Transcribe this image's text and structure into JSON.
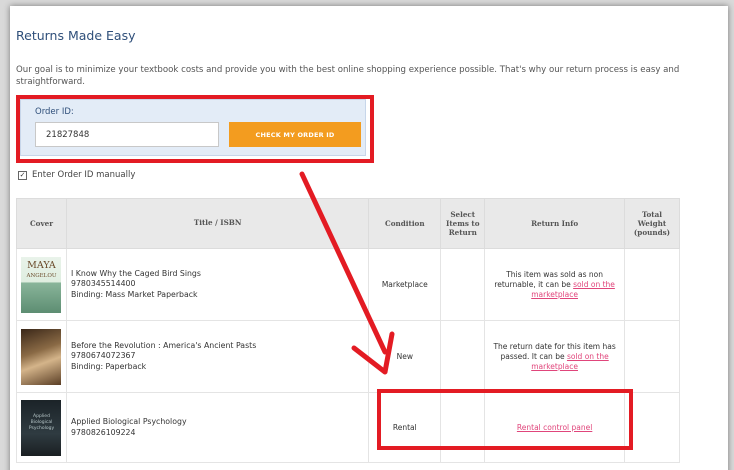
{
  "page": {
    "title": "Returns Made Easy",
    "intro": "Our goal is to minimize your textbook costs and provide you with the best online shopping experience possible. That's why our return process is easy and straightforward."
  },
  "order": {
    "label": "Order ID:",
    "value": "21827848",
    "button": "CHECK MY ORDER ID"
  },
  "manual": {
    "label": "Enter Order ID manually",
    "checked": true
  },
  "table": {
    "headers": {
      "cover": "Cover",
      "title": "Title / ISBN",
      "condition": "Condition",
      "select": "Select Items to Return",
      "return": "Return Info",
      "weight": "Total Weight (pounds)"
    },
    "rows": [
      {
        "cover_text": "MAYA",
        "cover_sub": "ANGELOU",
        "title": "I Know Why the Caged Bird Sings",
        "isbn": "9780345514400",
        "binding": "Binding: Mass Market Paperback",
        "condition": "Marketplace",
        "return_text": "This item was sold as non returnable, it can be",
        "return_link": "sold on the marketplace"
      },
      {
        "title": "Before the Revolution : America's Ancient Pasts",
        "isbn": "9780674072367",
        "binding": "Binding: Paperback",
        "condition": "New",
        "return_text": "The return date for this item has passed. It can be",
        "return_link": "sold on the marketplace"
      },
      {
        "cover_text": "Applied Biological Psychology",
        "title": "Applied Biological Psychology",
        "isbn": "9780826109224",
        "condition": "Rental",
        "return_link": "Rental control panel"
      }
    ]
  },
  "colors": {
    "accent_orange": "#f39c1f",
    "highlight_red": "#e31b23",
    "link_pink": "#e0457b",
    "title_blue": "#2f4f7a"
  }
}
